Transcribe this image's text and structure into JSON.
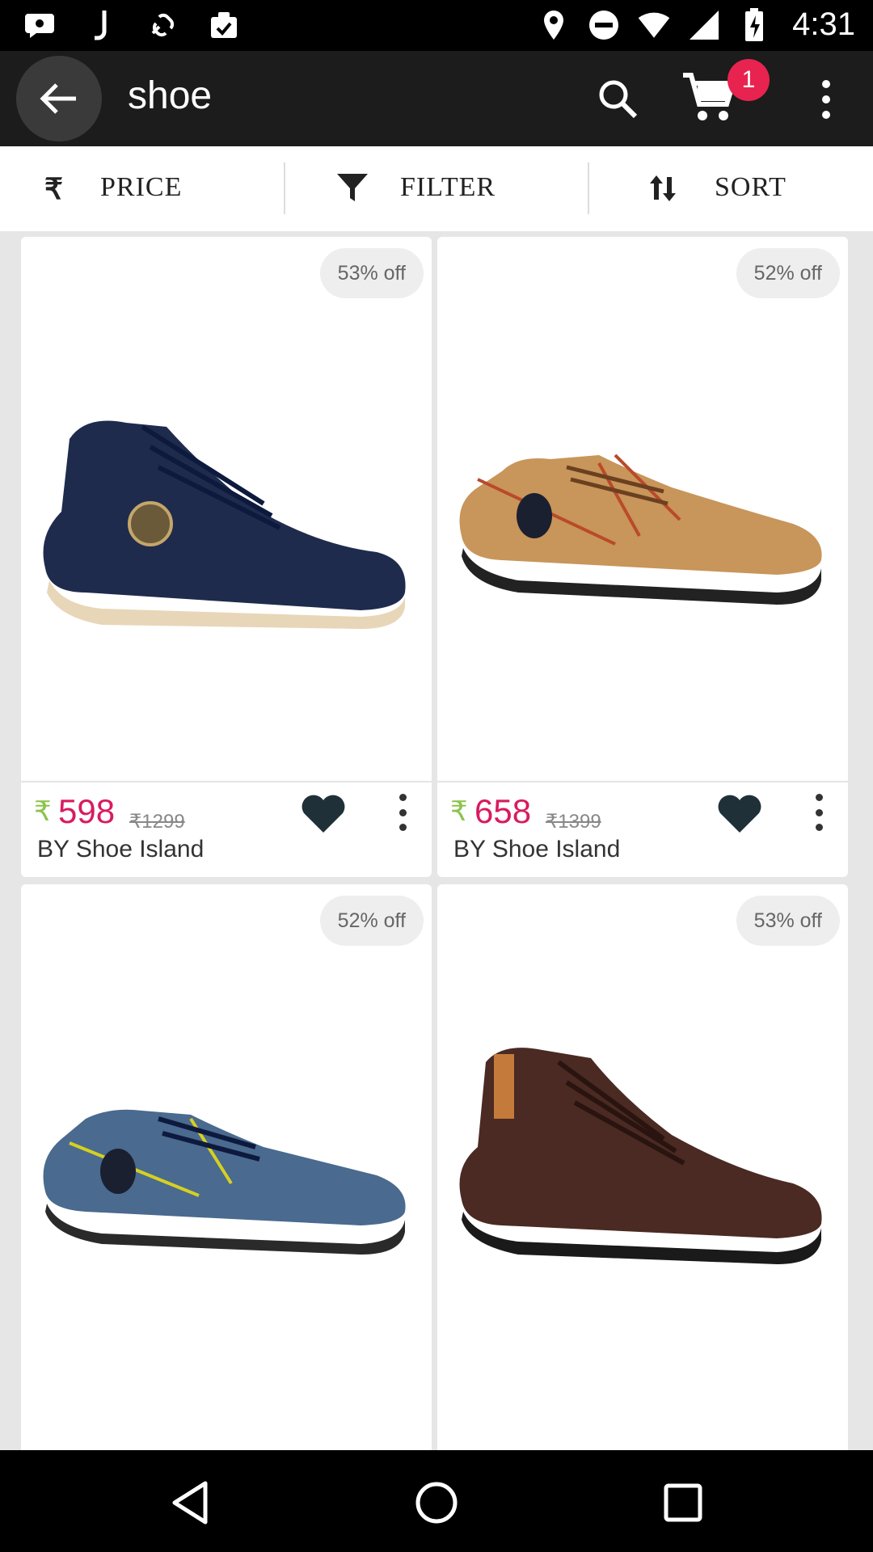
{
  "status_bar": {
    "time": "4:31",
    "left_icons": [
      "chat-bubble-icon",
      "j-app-icon",
      "link-app-icon",
      "clipboard-check-icon"
    ],
    "right_icons": [
      "location-icon",
      "do-not-disturb-icon",
      "wifi-icon",
      "cellular-icon",
      "battery-charging-icon"
    ]
  },
  "app_bar": {
    "title": "shoe",
    "cart_count": "1",
    "icons": [
      "back-arrow-icon",
      "search-icon",
      "cart-icon",
      "more-vert-icon"
    ]
  },
  "filter_bar": {
    "price": {
      "symbol": "₹",
      "label": "PRICE"
    },
    "filter": {
      "label": "FILTER"
    },
    "sort": {
      "label": "SORT"
    }
  },
  "products": [
    {
      "discount": "53% off",
      "currency": "₹",
      "price": "598",
      "old_price": "₹1299",
      "brand": "BY Shoe Island",
      "shoe_color": "#1f2b4d",
      "sole_color": "#e8d6b8"
    },
    {
      "discount": "52% off",
      "currency": "₹",
      "price": "658",
      "old_price": "₹1399",
      "brand": "BY Shoe Island",
      "shoe_color": "#c8955a",
      "sole_color": "#222222"
    },
    {
      "discount": "52% off",
      "shoe_color": "#4a6a8f",
      "sole_color": "#2a2a2a"
    },
    {
      "discount": "53% off",
      "shoe_color": "#4a2a22",
      "sole_color": "#1a1a1a"
    }
  ],
  "colors": {
    "price": "#d81b60",
    "currency": "#8bc34a",
    "badge": "#e8234f"
  }
}
